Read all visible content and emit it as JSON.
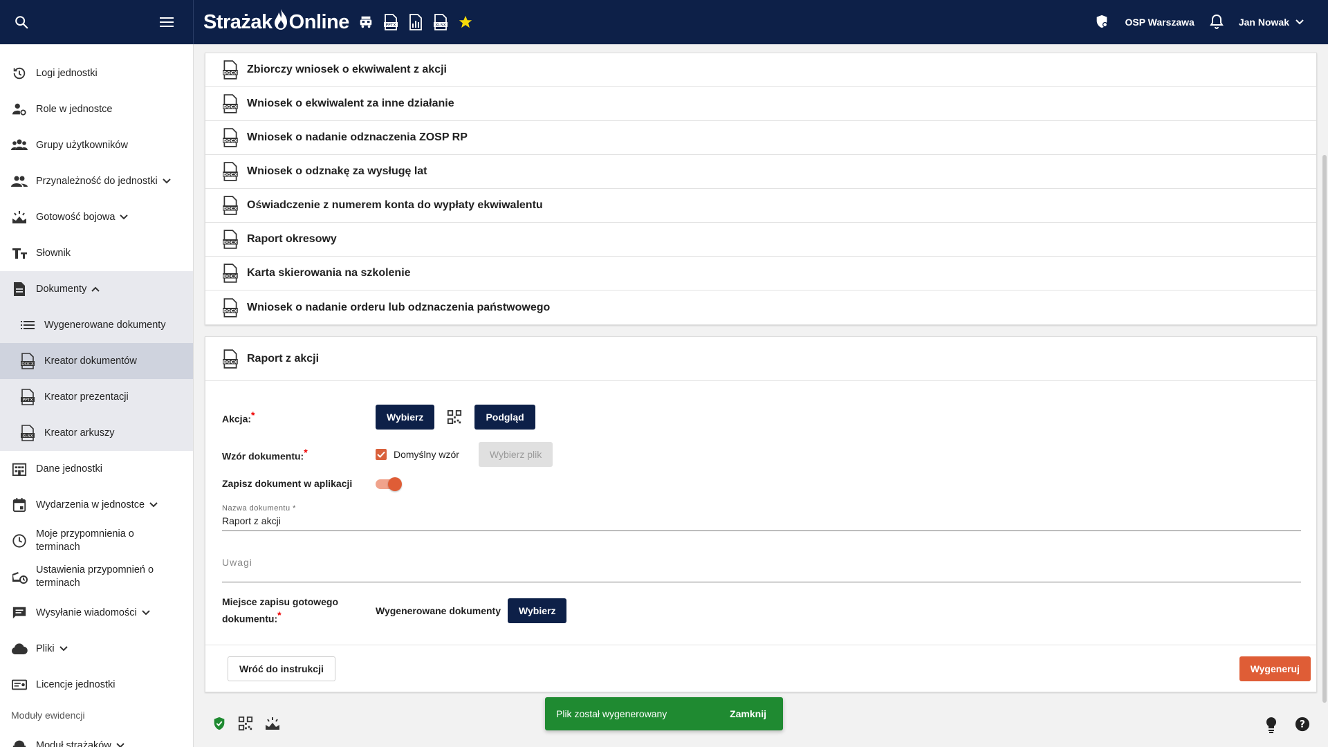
{
  "header": {
    "brand": "Strażak",
    "brand_suffix": "Online",
    "unit": "OSP Warszawa",
    "user": "Jan Nowak",
    "icons": [
      "search-icon",
      "menu-icon",
      "fire-truck-icon",
      "pptx-icon",
      "report-icon",
      "xlsx-icon",
      "star-icon",
      "shield-icon",
      "bell-icon",
      "chevron-down-icon"
    ],
    "accent": "#0d2048"
  },
  "sidebar": {
    "items": [
      {
        "label": "Logi jednostki"
      },
      {
        "label": "Role w jednostce"
      },
      {
        "label": "Grupy użytkowników"
      },
      {
        "label": "Przynależność do jednostki"
      },
      {
        "label": "Gotowość bojowa"
      },
      {
        "label": "Słownik"
      },
      {
        "label": "Dokumenty"
      },
      {
        "label": "Wygenerowane dokumenty"
      },
      {
        "label": "Kreator dokumentów"
      },
      {
        "label": "Kreator prezentacji"
      },
      {
        "label": "Kreator arkuszy"
      },
      {
        "label": "Dane jednostki"
      },
      {
        "label": "Wydarzenia w jednostce"
      },
      {
        "label": "Moje przypomnienia o terminach"
      },
      {
        "label": "Ustawienia przypomnień o terminach"
      },
      {
        "label": "Wysyłanie wiadomości"
      },
      {
        "label": "Pliki"
      },
      {
        "label": "Licencje jednostki"
      },
      {
        "label": "Moduł strażaków"
      }
    ],
    "section": "Moduły ewidencji"
  },
  "documents": [
    "Zbiorczy wniosek o ekwiwalent z akcji",
    "Wniosek o ekwiwalent za inne działanie",
    "Wniosek o nadanie odznaczenia ZOSP RP",
    "Wniosek o odznakę za wysługę lat",
    "Oświadczenie z numerem konta do wypłaty ekwiwalentu",
    "Raport okresowy",
    "Karta skierowania na szkolenie",
    "Wniosek o nadanie orderu lub odznaczenia państwowego"
  ],
  "form": {
    "title": "Raport z akcji",
    "action_label": "Akcja:",
    "choose": "Wybierz",
    "preview": "Podgląd",
    "template_label": "Wzór dokumentu:",
    "default_template": "Domyślny wzór",
    "choose_file": "Wybierz plik",
    "save_label": "Zapisz dokument w aplikacji",
    "name_label": "Nazwa dokumentu *",
    "name_value": "Raport z akcji",
    "notes_placeholder": "Uwagi",
    "location_label": "Miejsce zapisu gotowego dokumentu:",
    "location_value": "Wygenerowane dokumenty",
    "back": "Wróć do instrukcji",
    "generate": "Wygeneruj",
    "default_template_checked": true,
    "save_enabled": true,
    "accent": "#df5d36"
  },
  "snackbar": {
    "message": "Plik został wygenerowany",
    "action": "Zamknij",
    "color": "#1f8a31"
  }
}
